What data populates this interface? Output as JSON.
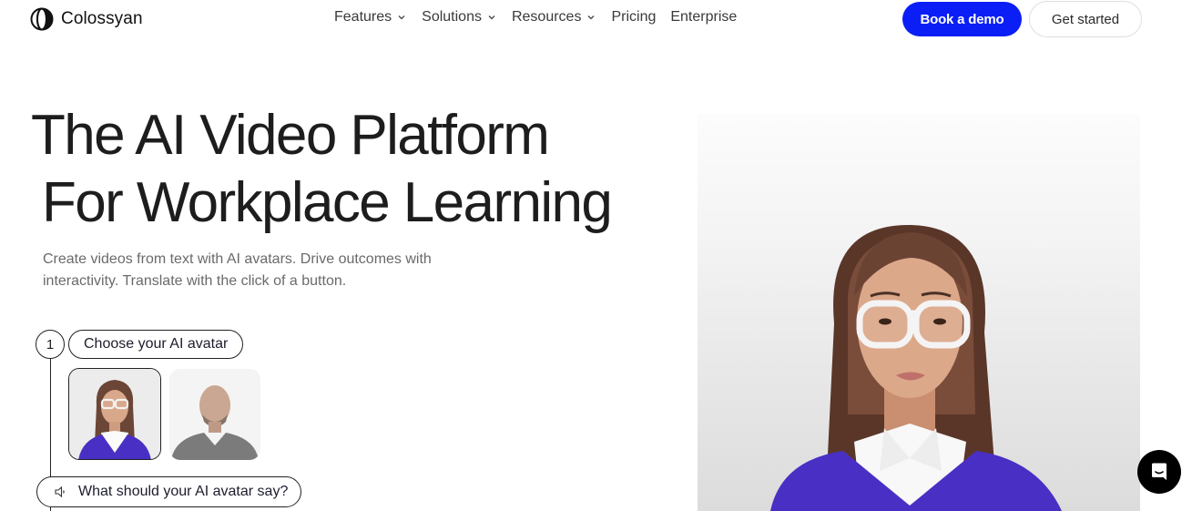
{
  "brand": {
    "name": "Colossyan",
    "logo_icon": "colossyan-logo-icon"
  },
  "nav": {
    "items": [
      {
        "label": "Features",
        "has_dropdown": true
      },
      {
        "label": "Solutions",
        "has_dropdown": true
      },
      {
        "label": "Resources",
        "has_dropdown": true
      },
      {
        "label": "Pricing",
        "has_dropdown": false
      },
      {
        "label": "Enterprise",
        "has_dropdown": false
      }
    ],
    "cta_primary": "Book a demo",
    "cta_secondary": "Get started"
  },
  "hero": {
    "title_line1": "The AI Video Platform",
    "title_line2": "For Workplace Learning",
    "subtitle": "Create videos from text with AI avatars. Drive outcomes with interactivity. Translate with the click of a button."
  },
  "steps": {
    "step1": {
      "number": "1",
      "label": "Choose your AI avatar"
    },
    "avatars": [
      {
        "name": "female-avatar-glasses",
        "selected": true
      },
      {
        "name": "male-avatar-bald",
        "selected": false
      }
    ],
    "step2": {
      "label": "What should your AI avatar say?",
      "icon": "speaker-icon"
    }
  },
  "colors": {
    "primary": "#0a1ef5",
    "text": "#1d1d1d",
    "muted": "#6a6a6a",
    "sweater": "#4a2fc4"
  },
  "chat_widget": {
    "icon": "chat-icon"
  }
}
